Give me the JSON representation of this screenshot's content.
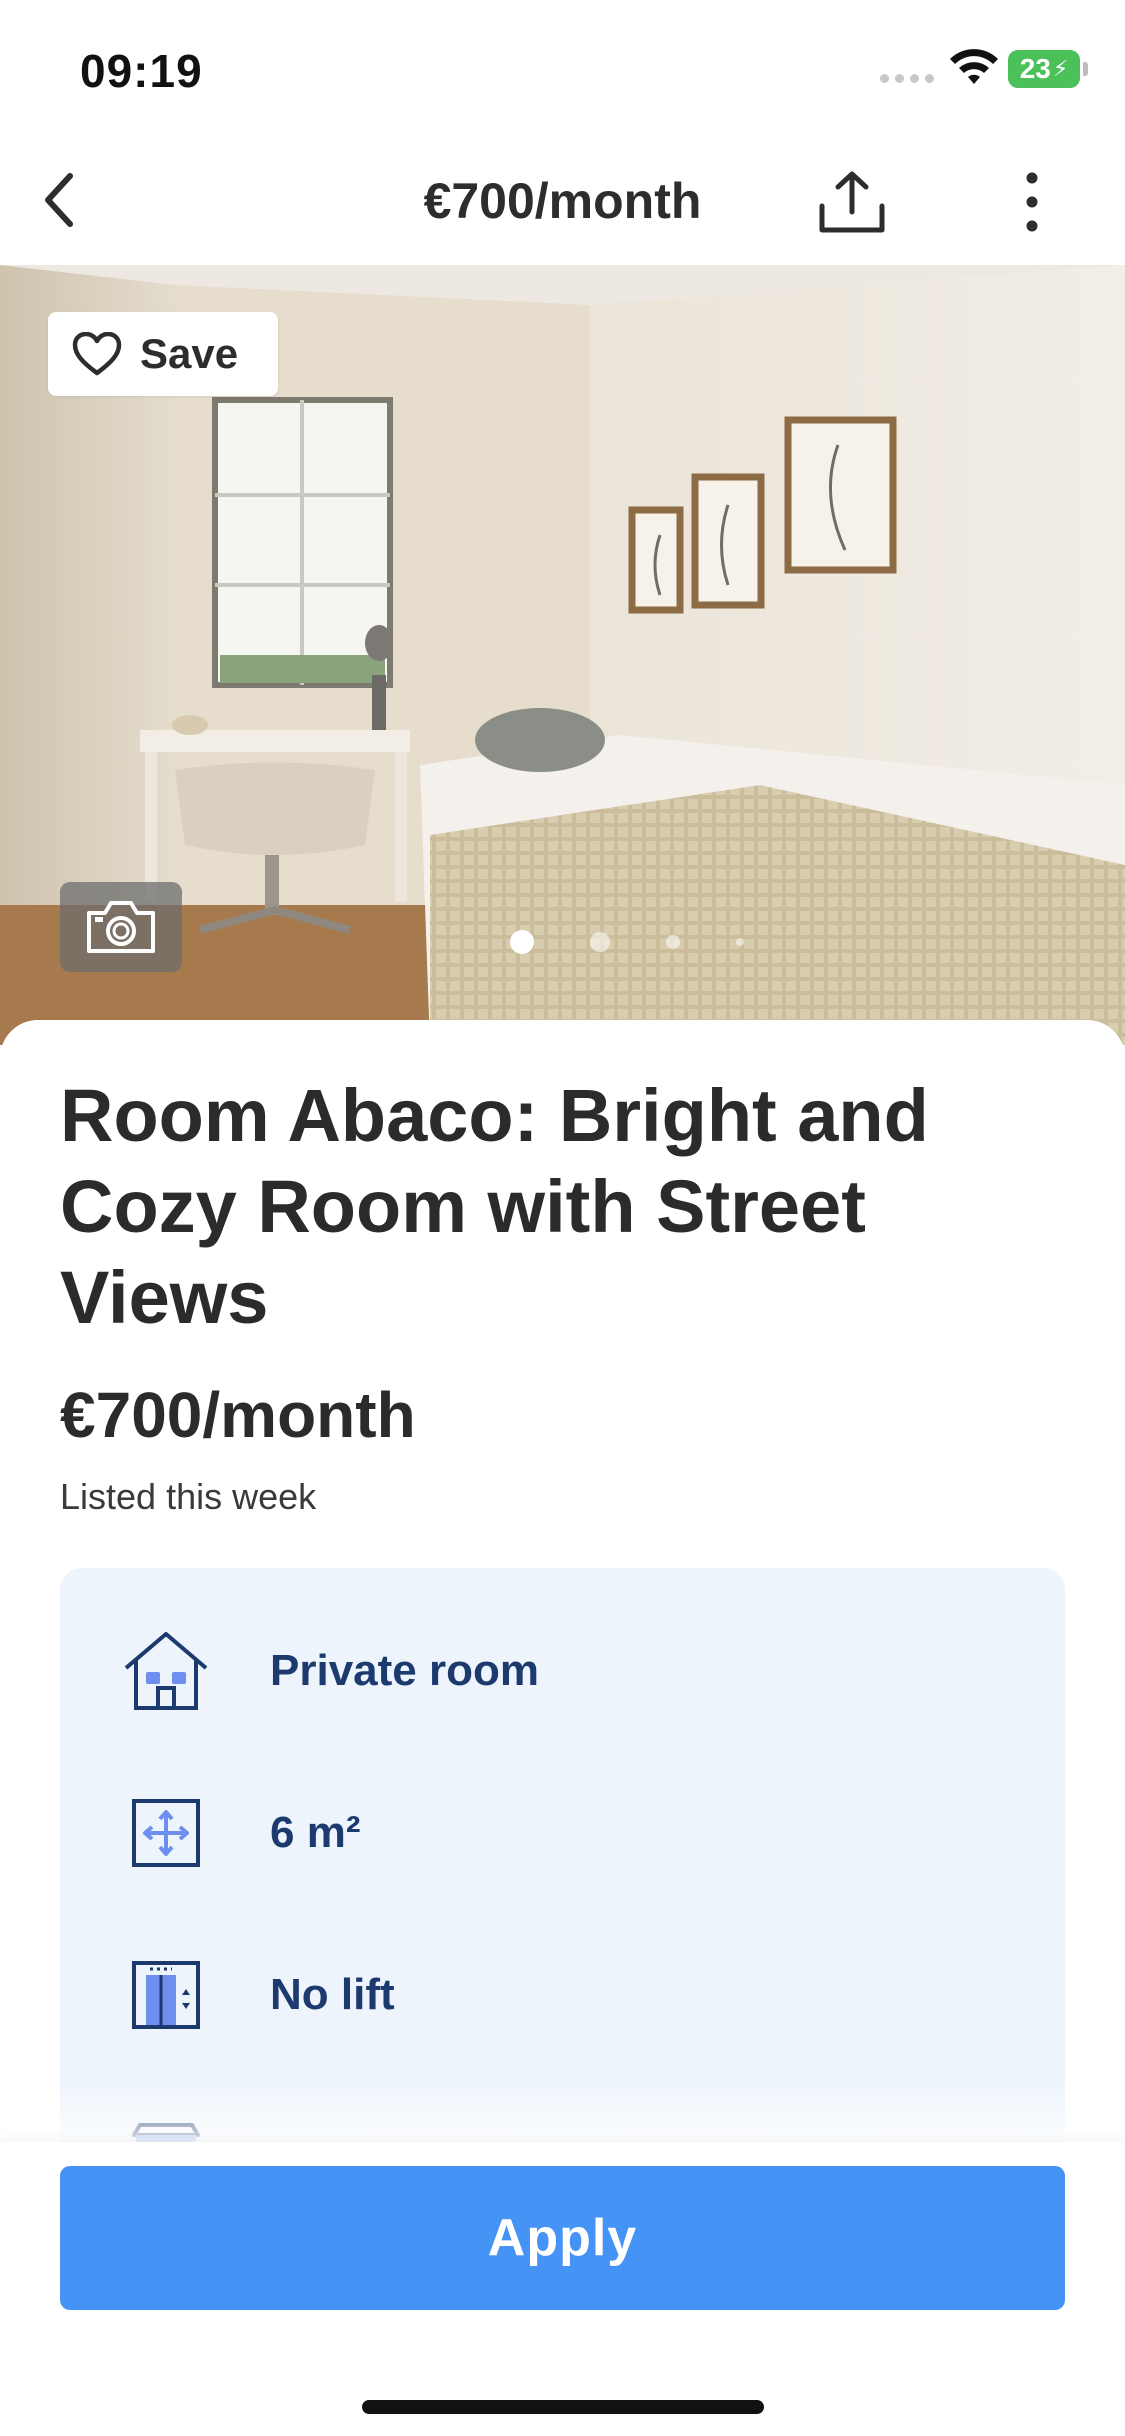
{
  "status_bar": {
    "time": "09:19",
    "battery_level": "23"
  },
  "header": {
    "title": "€700/month",
    "back_icon": "chevron-left-icon",
    "share_icon": "share-icon",
    "more_icon": "more-vertical-icon"
  },
  "photo": {
    "save_label": "Save",
    "save_icon": "heart-icon",
    "camera_icon": "camera-icon",
    "page_count": 4,
    "active_page": 1
  },
  "listing": {
    "title": "Room Abaco: Bright and Cozy Room with Street Views",
    "price": "€700/month",
    "listed": "Listed this week"
  },
  "features": [
    {
      "icon": "house-icon",
      "label": "Private room"
    },
    {
      "icon": "area-icon",
      "label": "6 m²"
    },
    {
      "icon": "lift-icon",
      "label": "No lift"
    },
    {
      "icon": "furniture-icon",
      "label": ""
    }
  ],
  "actions": {
    "apply_label": "Apply"
  },
  "colors": {
    "accent": "#4593f5",
    "feature_bg": "#edf4fc",
    "feature_text": "#1d3a6e",
    "battery": "#4cc15a"
  }
}
